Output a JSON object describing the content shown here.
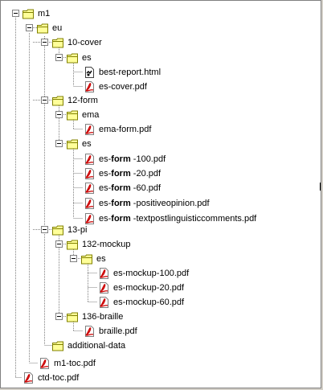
{
  "tree": {
    "root": {
      "label": "m1",
      "icon": "folder-icon"
    },
    "eu": {
      "label": "eu",
      "icon": "folder-icon"
    },
    "cover": {
      "label": "10-cover",
      "icon": "folder-icon"
    },
    "cover_es": {
      "label": "es",
      "icon": "folder-icon"
    },
    "best_report": {
      "label": "best-report.html",
      "icon": "html-file-icon"
    },
    "es_cover": {
      "label": "es-cover.pdf",
      "icon": "pdf-file-icon"
    },
    "form": {
      "label": "12-form",
      "icon": "folder-icon"
    },
    "ema": {
      "label": "ema",
      "icon": "folder-icon"
    },
    "ema_form": {
      "label": "ema-form.pdf",
      "icon": "pdf-file-icon"
    },
    "form_es": {
      "label": "es",
      "icon": "folder-icon"
    },
    "form_100": {
      "prefix": "es-",
      "bold": "form",
      "suffix": " -100.pdf",
      "icon": "pdf-file-icon"
    },
    "form_20": {
      "prefix": "es-",
      "bold": "form",
      "suffix": " -20.pdf",
      "icon": "pdf-file-icon"
    },
    "form_60": {
      "prefix": "es-",
      "bold": "form",
      "suffix": " -60.pdf",
      "icon": "pdf-file-icon"
    },
    "form_pos": {
      "prefix": "es-",
      "bold": "form",
      "suffix": " -positiveopinion.pdf",
      "icon": "pdf-file-icon"
    },
    "form_text": {
      "prefix": "es-",
      "bold": "form",
      "suffix": " -textpostlinguisticcomments.pdf",
      "icon": "pdf-file-icon"
    },
    "pi": {
      "label": "13-pi",
      "icon": "folder-icon"
    },
    "mockup": {
      "label": "132-mockup",
      "icon": "folder-icon"
    },
    "mockup_es": {
      "label": "es",
      "icon": "folder-icon"
    },
    "mockup_100": {
      "label": "es-mockup-100.pdf",
      "icon": "pdf-file-icon"
    },
    "mockup_20": {
      "label": "es-mockup-20.pdf",
      "icon": "pdf-file-icon"
    },
    "mockup_60": {
      "label": "es-mockup-60.pdf",
      "icon": "pdf-file-icon"
    },
    "braille": {
      "label": "136-braille",
      "icon": "folder-icon"
    },
    "braille_pdf": {
      "label": "braille.pdf",
      "icon": "pdf-file-icon"
    },
    "additional": {
      "label": "additional-data",
      "icon": "folder-icon"
    },
    "m1_toc": {
      "label": "m1-toc.pdf",
      "icon": "pdf-file-icon"
    },
    "ctd_toc": {
      "label": "ctd-toc.pdf",
      "icon": "pdf-file-icon"
    }
  },
  "colors": {
    "folder": "#ffff99",
    "folder_border": "#808000",
    "pdf_red": "#cc0000",
    "line": "#808080"
  }
}
